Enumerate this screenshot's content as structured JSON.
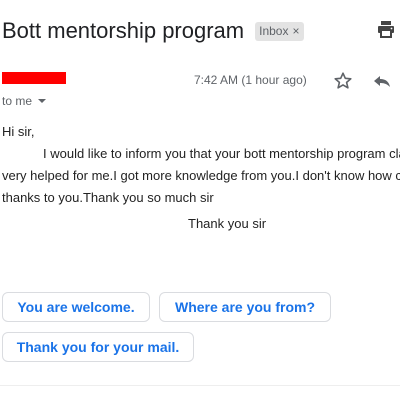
{
  "email": {
    "subject": "Bott mentorship program",
    "label": "Inbox",
    "label_remove": "×",
    "timestamp": "7:42 AM (1 hour ago)",
    "recipient": "to me",
    "body": {
      "greeting": "Hi sir,",
      "line1": "I would like to inform you that your bott mentorship program clas",
      "line2": "very helped for me.I got more knowledge from you.I don't know how ca",
      "line3": "thanks to you.Thank you so much sir",
      "signoff": "Thank you sir"
    }
  },
  "smart_replies": [
    "You are welcome.",
    "Where are you from?",
    "Thank you for your mail."
  ],
  "colors": {
    "accent": "#1a73e8",
    "redaction": "#ff0000",
    "label_bg": "#e3e3e3"
  },
  "icons": [
    "print-icon",
    "star-icon",
    "reply-icon",
    "chevron-down-icon"
  ]
}
